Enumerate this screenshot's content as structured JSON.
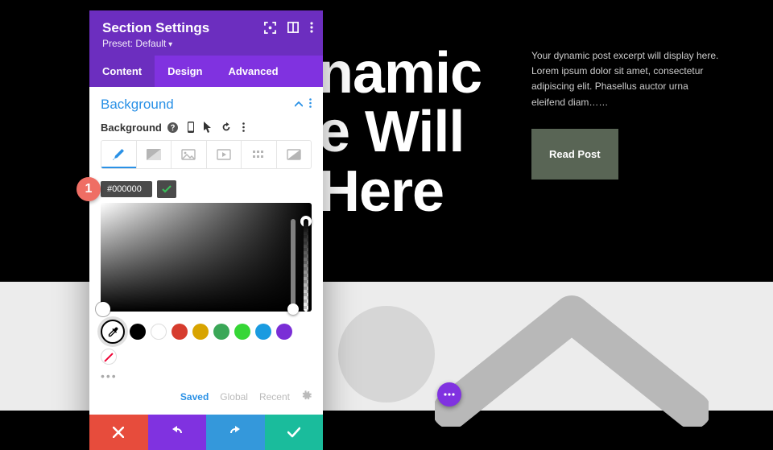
{
  "panel": {
    "title": "Section Settings",
    "preset_label": "Preset: Default",
    "tabs": {
      "content": "Content",
      "design": "Design",
      "advanced": "Advanced"
    },
    "section_title": "Background",
    "background_label": "Background",
    "color_hex": "#000000",
    "palette_tabs": {
      "saved": "Saved",
      "global": "Global",
      "recent": "Recent"
    },
    "swatches": [
      "#000000",
      "#ffffff",
      "#d63c2e",
      "#d8a400",
      "#3aa757",
      "#36d636",
      "#1a9be0",
      "#7a2ed6"
    ]
  },
  "hero": {
    "line1": "namic",
    "line2": "e Will",
    "line3": "Here"
  },
  "excerpt": "Your dynamic post excerpt will display here. Lorem ipsum dolor sit amet, consectetur adipiscing elit. Phasellus auctor urna eleifend diam……",
  "read_post": "Read Post",
  "badge": "1"
}
